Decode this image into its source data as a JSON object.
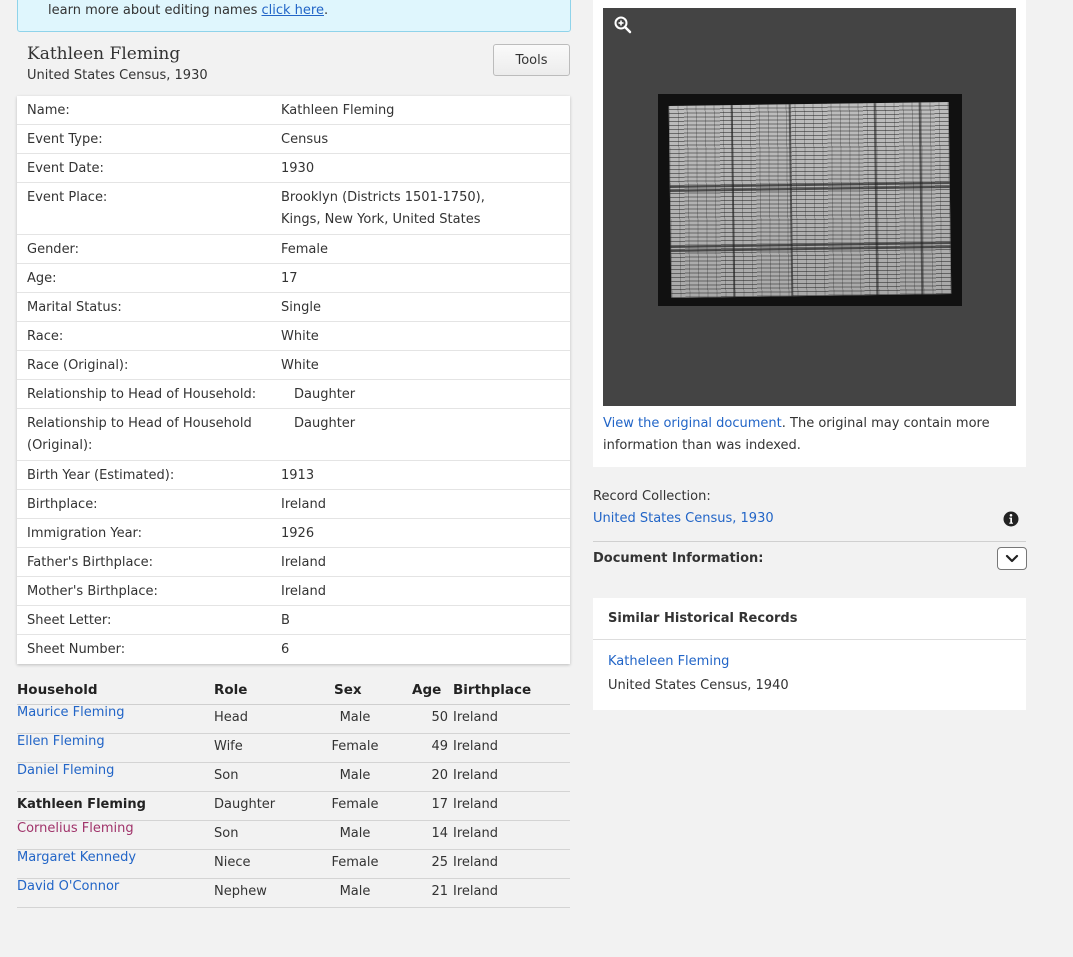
{
  "banner": {
    "text": "learn more about editing names",
    "link": "click here",
    "tail": "."
  },
  "record": {
    "title": "Kathleen Fleming",
    "subtitle": "United States Census, 1930",
    "tools_label": "Tools"
  },
  "details": [
    {
      "label": "Name:",
      "value": "Kathleen Fleming"
    },
    {
      "label": "Event Type:",
      "value": "Census"
    },
    {
      "label": "Event Date:",
      "value": "1930"
    },
    {
      "label": "Event Place:",
      "value": "Brooklyn (Districts 1501-1750),",
      "value2": "Kings, New York, United States"
    },
    {
      "label": "Gender:",
      "value": "Female"
    },
    {
      "label": "Age:",
      "value": "17"
    },
    {
      "label": "Marital Status:",
      "value": "Single"
    },
    {
      "label": "Race:",
      "value": "White"
    },
    {
      "label": "Race (Original):",
      "value": "White"
    },
    {
      "label": "Relationship to Head of Household:",
      "value": "Daughter"
    },
    {
      "label": "Relationship to Head of Household",
      "label2": "(Original):",
      "value": "Daughter"
    },
    {
      "label": "Birth Year (Estimated):",
      "value": "1913"
    },
    {
      "label": "Birthplace:",
      "value": "Ireland"
    },
    {
      "label": "Immigration Year:",
      "value": "1926"
    },
    {
      "label": "Father's Birthplace:",
      "value": "Ireland"
    },
    {
      "label": "Mother's Birthplace:",
      "value": "Ireland"
    },
    {
      "label": "Sheet Letter:",
      "value": "B"
    },
    {
      "label": "Sheet Number:",
      "value": "6"
    }
  ],
  "household": {
    "headers": {
      "household": "Household",
      "role": "Role",
      "sex": "Sex",
      "age": "Age",
      "birthplace": "Birthplace"
    },
    "rows": [
      {
        "name": "Maurice Fleming",
        "role": "Head",
        "sex": "Male",
        "age": "50",
        "birthplace": "Ireland"
      },
      {
        "name": "Ellen Fleming",
        "role": "Wife",
        "sex": "Female",
        "age": "49",
        "birthplace": "Ireland"
      },
      {
        "name": "Daniel Fleming",
        "role": "Son",
        "sex": "Male",
        "age": "20",
        "birthplace": "Ireland"
      },
      {
        "name": "Kathleen Fleming",
        "role": "Daughter",
        "sex": "Female",
        "age": "17",
        "birthplace": "Ireland"
      },
      {
        "name": "Cornelius Fleming",
        "role": "Son",
        "sex": "Male",
        "age": "14",
        "birthplace": "Ireland"
      },
      {
        "name": "Margaret Kennedy",
        "role": "Niece",
        "sex": "Female",
        "age": "25",
        "birthplace": "Ireland"
      },
      {
        "name": "David O'Connor",
        "role": "Nephew",
        "sex": "Male",
        "age": "21",
        "birthplace": "Ireland"
      }
    ]
  },
  "viewer": {
    "view_link": "View the original document",
    "view_text": ". The original may contain more information than was indexed."
  },
  "collection": {
    "label": "Record Collection:",
    "link": "United States Census, 1930",
    "doc_info": "Document Information:"
  },
  "similar": {
    "title": "Similar Historical Records",
    "link": "Katheleen Fleming",
    "sub": "United States Census, 1940"
  },
  "colors": {
    "link": "#2265c7",
    "visited": "#a0336a",
    "current": "#222222"
  },
  "icons": {
    "zoom": "zoom-in-icon",
    "info": "info-icon",
    "chevron": "chevron-down-icon"
  }
}
